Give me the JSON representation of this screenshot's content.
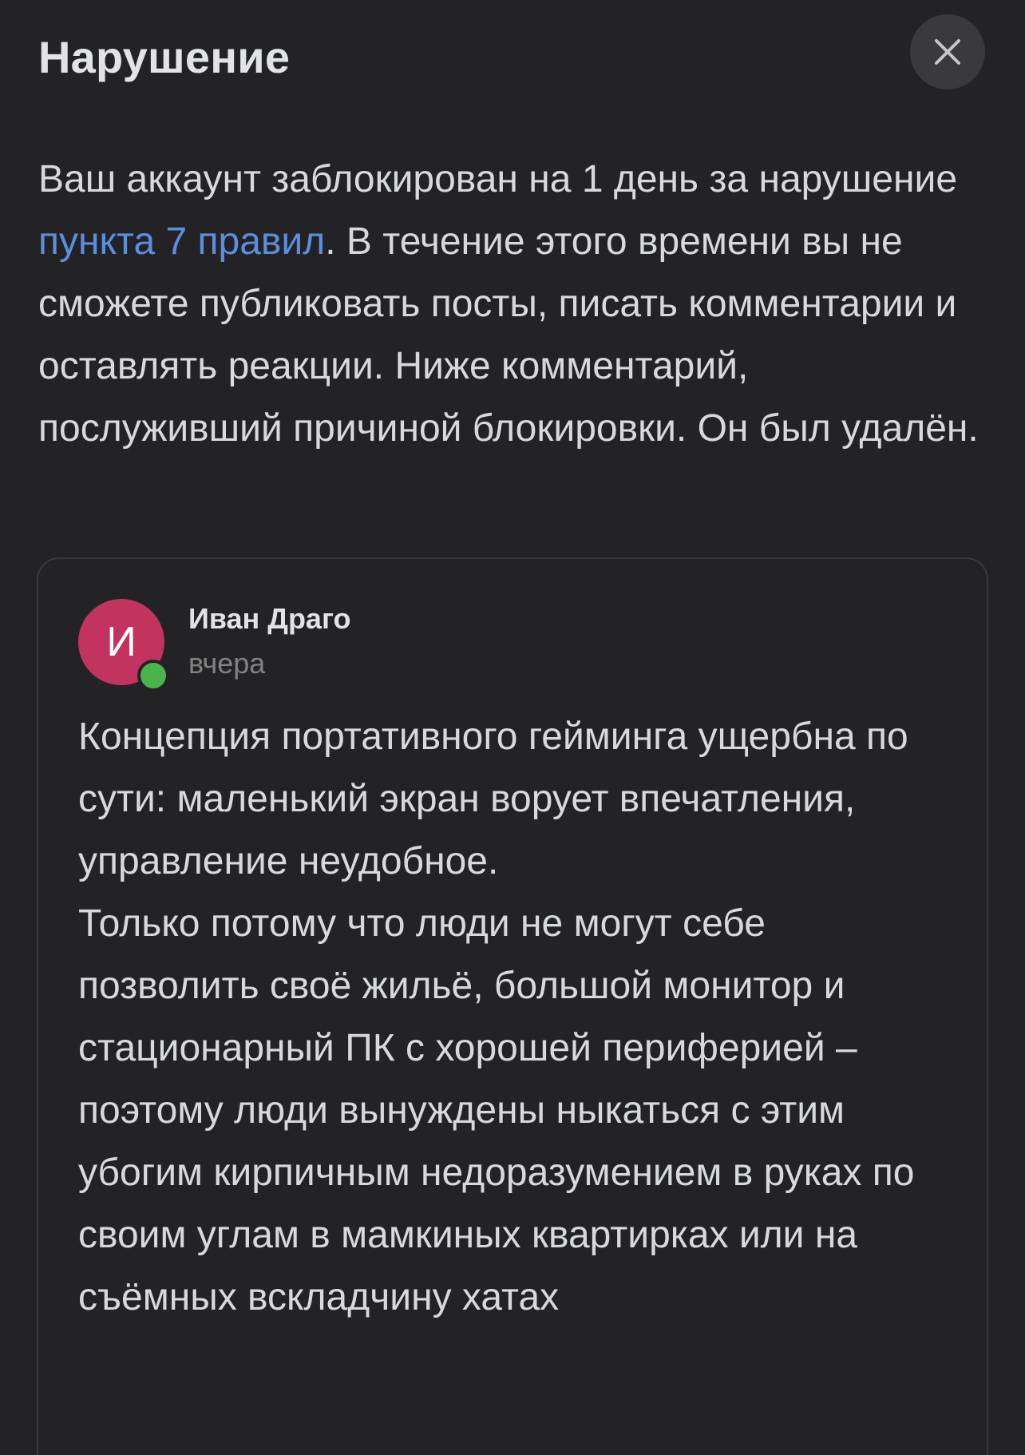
{
  "modal": {
    "title": "Нарушение",
    "close_icon": "close-icon"
  },
  "notice": {
    "text_before": "Ваш аккаунт заблокирован на 1 день за нарушение ",
    "link_text": "пункта 7 правил",
    "text_after": ". В течение этого времени вы не сможете публиковать посты, писать комментарии и оставлять реакции. Ниже комментарий, послуживший причиной блокировки. Он был удалён.",
    "link_color": "#5b8fdd"
  },
  "comment": {
    "author": "Иван Драго",
    "avatar_letter": "И",
    "avatar_color": "#c2345f",
    "online_color": "#4bb34b",
    "time": "вчера",
    "paragraph_1": "Концепция портативного гейминга ущербна по сути: маленький экран ворует впечатления, управление неудобное.",
    "paragraph_2": "Только потому что люди не могут себе позволить своё жильё, большой монитор и стационарный ПК с хорошей периферией – поэтому люди вынуждены ныкаться с этим убогим кирпичным недоразумением в руках по своим углам в мамкиных квартирках или на съёмных вскладчину хатах"
  }
}
